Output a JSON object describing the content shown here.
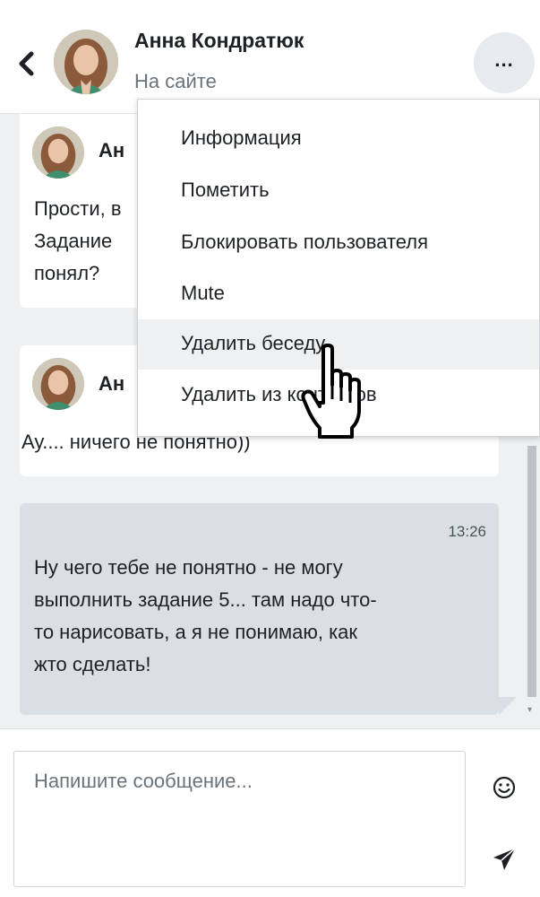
{
  "header": {
    "contact_name": "Анна Кондратюк",
    "status": "На сайте",
    "more_label": "..."
  },
  "messages": [
    {
      "sender": "Анна Кондратюк",
      "sender_visible": "Ан",
      "lines": [
        "Прости, в",
        "Задание",
        "понял?"
      ]
    },
    {
      "sender": "Анна Кондратюк",
      "sender_visible": "Ан",
      "lines": [
        "Ау.... ничего не понятно))"
      ]
    },
    {
      "time": "13:26",
      "lines": [
        "Ну чего тебе не понятно - не могу",
        "выполнить задание 5... там надо что-",
        "то нарисовать, а я не понимаю, как",
        "жто сделать!"
      ]
    }
  ],
  "menu": {
    "items": [
      {
        "label": "Информация"
      },
      {
        "label": "Пометить"
      },
      {
        "label": "Блокировать пользователя"
      },
      {
        "label": "Mute"
      },
      {
        "label": "Удалить беседу"
      },
      {
        "label": "Удалить из контактов"
      }
    ],
    "hovered_index": 4
  },
  "composer": {
    "placeholder": "Напишите сообщение...",
    "emoji_icon": "smiley-icon",
    "send_icon": "paper-plane-icon"
  },
  "colors": {
    "conversation_bg": "#eef0f2",
    "own_message_bg": "#d9dfe5",
    "more_button_bg": "#e7eaee"
  }
}
